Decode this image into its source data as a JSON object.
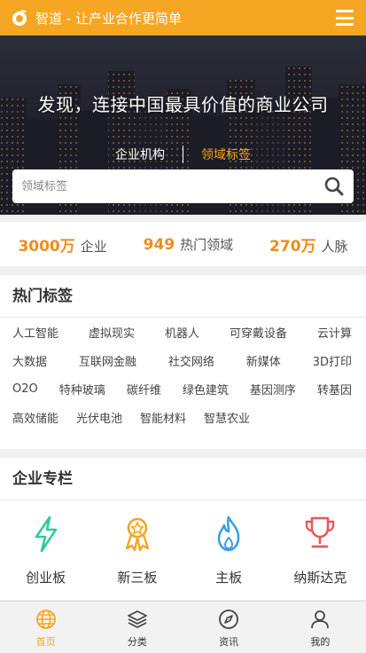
{
  "header": {
    "brand": "智道 - 让产业合作更简单",
    "logo_icon": "logo-icon",
    "menu_icon": "hamburger-menu-icon"
  },
  "hero": {
    "title": "发现，连接中国最具价值的商业公司",
    "tabs": [
      {
        "label": "企业机构",
        "active": false
      },
      {
        "label": "领域标签",
        "active": true
      }
    ],
    "search": {
      "placeholder": "领域标签",
      "value": "",
      "icon": "search-icon"
    }
  },
  "stats": [
    {
      "value": "3000万",
      "label": "企业"
    },
    {
      "value": "949",
      "label": "热门领域"
    },
    {
      "value": "270万",
      "label": "人脉"
    }
  ],
  "hot_tags": {
    "title": "热门标签",
    "rows": [
      [
        "人工智能",
        "虚拟现实",
        "机器人",
        "可穿戴设备",
        "云计算"
      ],
      [
        "大数据",
        "互联网金融",
        "社交网络",
        "新媒体",
        "3D打印"
      ],
      [
        "O2O",
        "特种玻璃",
        "碳纤维",
        "绿色建筑",
        "基因测序",
        "转基因"
      ],
      [
        "高效储能",
        "光伏电池",
        "智能材料",
        "智慧农业"
      ]
    ]
  },
  "enterprise_column": {
    "title": "企业专栏",
    "items": [
      {
        "label": "创业板",
        "icon": "lightning-icon",
        "color": "#2ecc9a"
      },
      {
        "label": "新三板",
        "icon": "medal-icon",
        "color": "#f5a623"
      },
      {
        "label": "主板",
        "icon": "flame-icon",
        "color": "#3aa0e8"
      },
      {
        "label": "纳斯达克",
        "icon": "trophy-icon",
        "color": "#e85a5a"
      }
    ]
  },
  "bottom_nav": [
    {
      "label": "首页",
      "icon": "globe-icon",
      "active": true
    },
    {
      "label": "分类",
      "icon": "layers-icon",
      "active": false
    },
    {
      "label": "资讯",
      "icon": "compass-icon",
      "active": false
    },
    {
      "label": "我的",
      "icon": "user-icon",
      "active": false
    }
  ],
  "colors": {
    "accent": "#f5a623",
    "stat_number": "#f08c1c"
  }
}
